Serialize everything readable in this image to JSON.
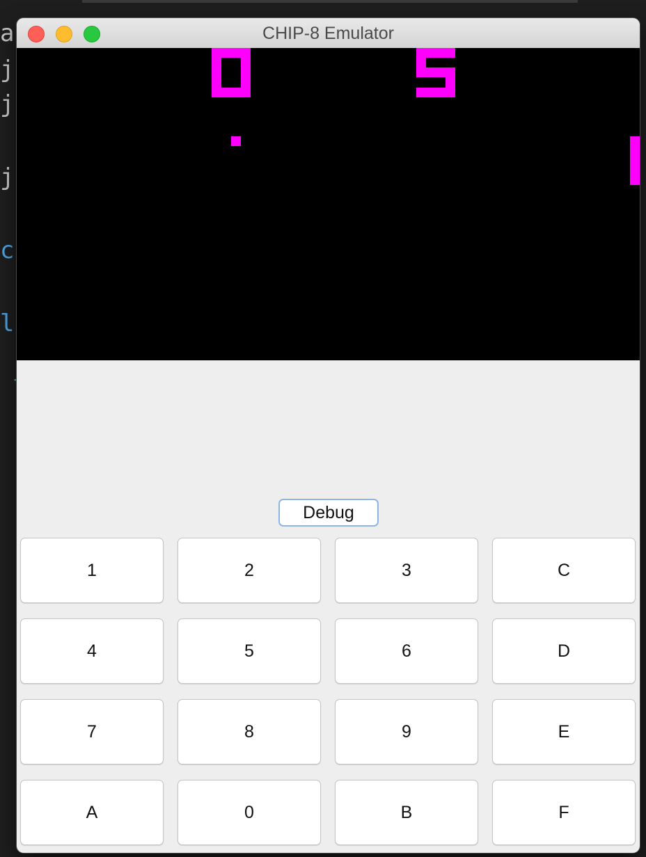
{
  "window": {
    "title": "CHIP-8 Emulator"
  },
  "display": {
    "pixel_color": "#ff00ff",
    "background_color": "#000000",
    "score_left": "0",
    "score_right": "5"
  },
  "controls": {
    "debug_label": "Debug"
  },
  "keypad": {
    "keys": [
      "1",
      "2",
      "3",
      "C",
      "4",
      "5",
      "6",
      "D",
      "7",
      "8",
      "9",
      "E",
      "A",
      "0",
      "B",
      "F"
    ]
  }
}
